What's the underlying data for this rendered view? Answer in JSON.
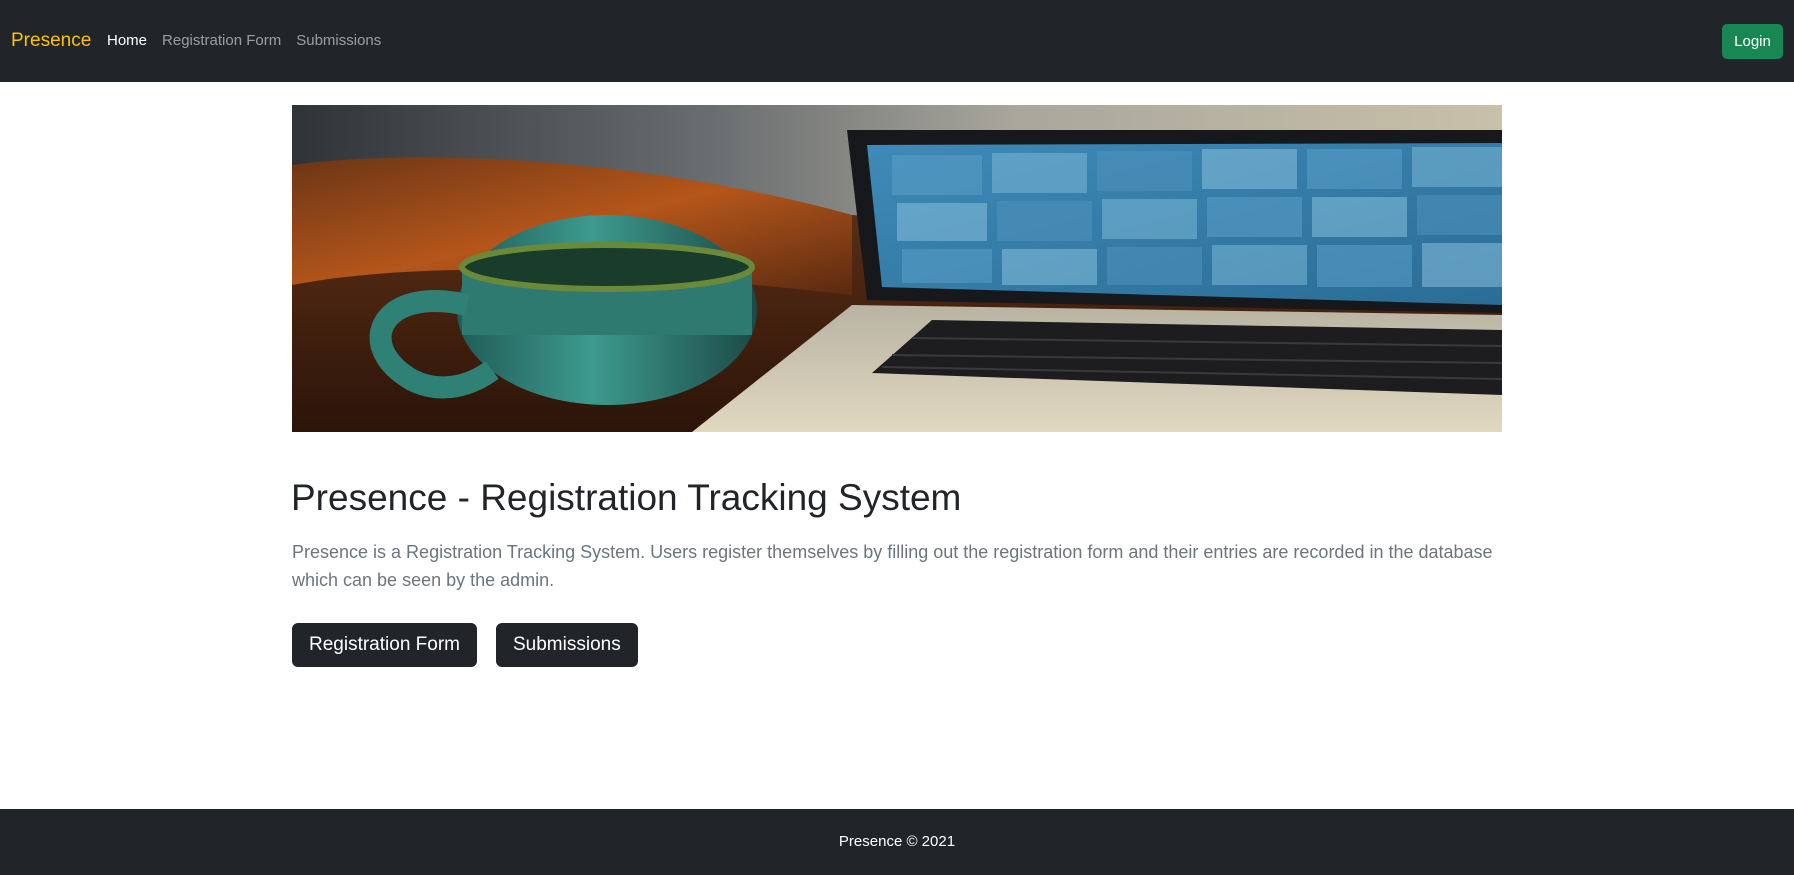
{
  "navbar": {
    "brand": "Presence",
    "links": [
      {
        "label": "Home",
        "active": true
      },
      {
        "label": "Registration Form",
        "active": false
      },
      {
        "label": "Submissions",
        "active": false
      }
    ],
    "login_label": "Login"
  },
  "hero": {
    "image": "coffee-mug-and-laptop-video-call-photo"
  },
  "main": {
    "title": "Presence - Registration Tracking System",
    "description": "Presence is a Registration Tracking System. Users register themselves by filling out the registration form and their entries are recorded in the database which can be seen by the admin.",
    "buttons": {
      "registration_form": "Registration Form",
      "submissions": "Submissions"
    }
  },
  "footer": {
    "text": "Presence © 2021"
  },
  "colors": {
    "navbar_bg": "#212529",
    "brand": "#ffc107",
    "login_button": "#198754",
    "dark_button": "#212529"
  }
}
